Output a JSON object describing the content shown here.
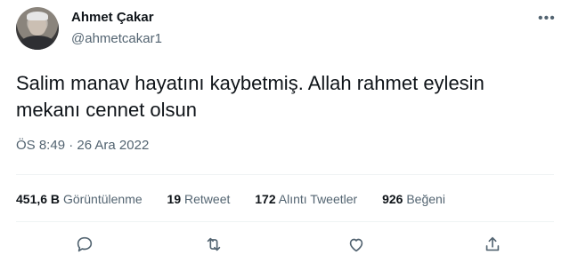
{
  "author": {
    "name": "Ahmet Çakar",
    "handle": "@ahmetcakar1"
  },
  "more_icon": "more-dots-icon",
  "tweet": {
    "line1": "Salim manav hayatını kaybetmiş. Allah rahmet eylesin",
    "line2": "mekanı cennet olsun",
    "time": "ÖS 8:49",
    "separator": " · ",
    "date": "26 Ara 2022"
  },
  "stats": {
    "views": {
      "value": "451,6 B",
      "label": "Görüntülenme"
    },
    "retweets": {
      "value": "19",
      "label": "Retweet"
    },
    "quotes": {
      "value": "172",
      "label": "Alıntı Tweetler"
    },
    "likes": {
      "value": "926",
      "label": "Beğeni"
    }
  },
  "actions": [
    "reply-icon",
    "retweet-icon",
    "like-icon",
    "share-icon"
  ],
  "colors": {
    "text": "#0f1419",
    "secondary": "#536471",
    "divider": "#eff3f4"
  }
}
